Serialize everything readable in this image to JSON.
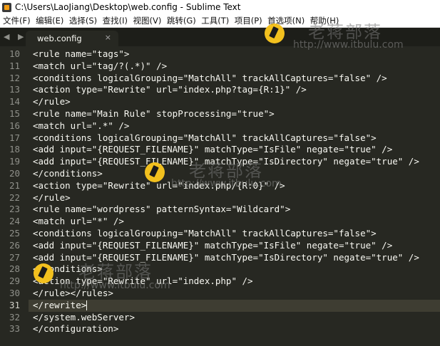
{
  "window": {
    "title": "C:\\Users\\LaoJiang\\Desktop\\web.config - Sublime Text"
  },
  "menu": [
    "文件(F)",
    "编辑(E)",
    "选择(S)",
    "查找(I)",
    "视图(V)",
    "跳转(G)",
    "工具(T)",
    "项目(P)",
    "首选项(N)",
    "帮助(H)"
  ],
  "tabs": {
    "nav": "◀ ▶",
    "active": {
      "label": "web.config",
      "close": "×"
    }
  },
  "editor": {
    "active_line": 31,
    "lines": [
      {
        "no": "10",
        "text": "<rule name=\"tags\">"
      },
      {
        "no": "11",
        "text": "<match url=\"tag/?(.*)\" />"
      },
      {
        "no": "12",
        "text": "<conditions logicalGrouping=\"MatchAll\" trackAllCaptures=\"false\" />"
      },
      {
        "no": "13",
        "text": "<action type=\"Rewrite\" url=\"index.php?tag={R:1}\" />"
      },
      {
        "no": "14",
        "text": "</rule>"
      },
      {
        "no": "15",
        "text": "<rule name=\"Main Rule\" stopProcessing=\"true\">"
      },
      {
        "no": "16",
        "text": "<match url=\".*\" />"
      },
      {
        "no": "17",
        "text": "<conditions logicalGrouping=\"MatchAll\" trackAllCaptures=\"false\">"
      },
      {
        "no": "18",
        "text": "<add input=\"{REQUEST_FILENAME}\" matchType=\"IsFile\" negate=\"true\" />"
      },
      {
        "no": "19",
        "text": "<add input=\"{REQUEST_FILENAME}\" matchType=\"IsDirectory\" negate=\"true\" />"
      },
      {
        "no": "20",
        "text": "</conditions>"
      },
      {
        "no": "21",
        "text": "<action type=\"Rewrite\" url=\"index.php/{R:0}\" />"
      },
      {
        "no": "22",
        "text": "</rule>"
      },
      {
        "no": "23",
        "text": "<rule name=\"wordpress\" patternSyntax=\"Wildcard\">"
      },
      {
        "no": "24",
        "text": "<match url=\"*\" />"
      },
      {
        "no": "25",
        "text": "<conditions logicalGrouping=\"MatchAll\" trackAllCaptures=\"false\">"
      },
      {
        "no": "26",
        "text": "<add input=\"{REQUEST_FILENAME}\" matchType=\"IsFile\" negate=\"true\" />"
      },
      {
        "no": "27",
        "text": "<add input=\"{REQUEST_FILENAME}\" matchType=\"IsDirectory\" negate=\"true\" />"
      },
      {
        "no": "28",
        "text": "</conditions>"
      },
      {
        "no": "29",
        "text": "<action type=\"Rewrite\" url=\"index.php\" />"
      },
      {
        "no": "30",
        "text": "</rule></rules>"
      },
      {
        "no": "31",
        "text": "</rewrite>"
      },
      {
        "no": "32",
        "text": "</system.webServer>"
      },
      {
        "no": "33",
        "text": "</configuration>"
      }
    ]
  },
  "watermark": {
    "cn": "老蒋部落",
    "url": "http://www.itbulu.com",
    "icon": "pencil-logo-icon"
  },
  "colors": {
    "editor_bg": "#272822",
    "active_line_bg": "#3e3d32",
    "gutter_fg": "#8f908a",
    "text_fg": "#f8f8f2"
  }
}
